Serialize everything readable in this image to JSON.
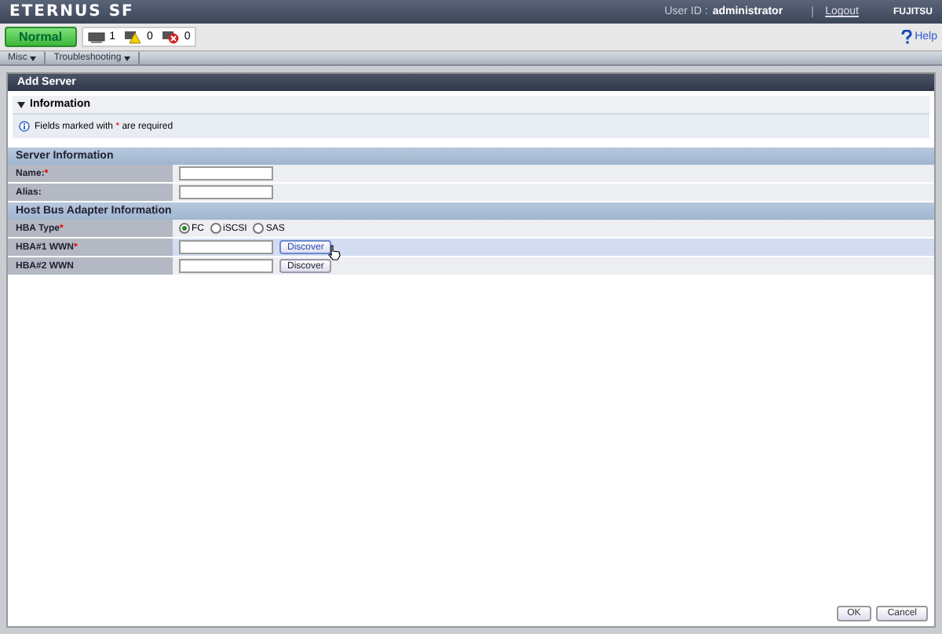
{
  "header": {
    "logo": "ETERNUS SF",
    "user_label": "User ID :",
    "user": "administrator",
    "logout": "Logout",
    "brand": "FUJITSU"
  },
  "toolbar": {
    "status": "Normal",
    "counters": [
      {
        "kind": "info",
        "count": "1"
      },
      {
        "kind": "warning",
        "count": "0"
      },
      {
        "kind": "error",
        "count": "0"
      }
    ],
    "help": "Help"
  },
  "menu": [
    {
      "label": "Misc"
    },
    {
      "label": "Troubleshooting"
    }
  ],
  "panel": {
    "title": "Add Server",
    "information": {
      "title": "Information",
      "expanded": true,
      "text_before": "Fields marked with",
      "mark": "*",
      "text_after": "are required"
    },
    "sections": [
      {
        "title": "Server Information",
        "rows": [
          {
            "kind": "text",
            "label": "Name:",
            "required": true,
            "mark": "*",
            "highlighted": false
          },
          {
            "kind": "text",
            "label": "Alias:",
            "required": false,
            "highlighted": false
          }
        ]
      },
      {
        "title": "Host Bus Adapter Information",
        "rows": [
          {
            "kind": "radio",
            "label": "HBA Type",
            "required": true,
            "mark": "*",
            "highlighted": false,
            "options": [
              {
                "label": "FC",
                "selected": true
              },
              {
                "label": "iSCSI",
                "selected": false
              },
              {
                "label": "SAS",
                "selected": false
              }
            ]
          },
          {
            "kind": "discover",
            "label": "HBA#1 WWN",
            "required": true,
            "mark": "*",
            "highlighted": true,
            "button": "Discover",
            "pointer": true
          },
          {
            "kind": "discover",
            "label": "HBA#2 WWN",
            "required": false,
            "highlighted": false,
            "button": "Discover",
            "pointer": false
          }
        ]
      }
    ]
  },
  "footer": {
    "buttons": [
      "OK",
      "Cancel"
    ]
  }
}
